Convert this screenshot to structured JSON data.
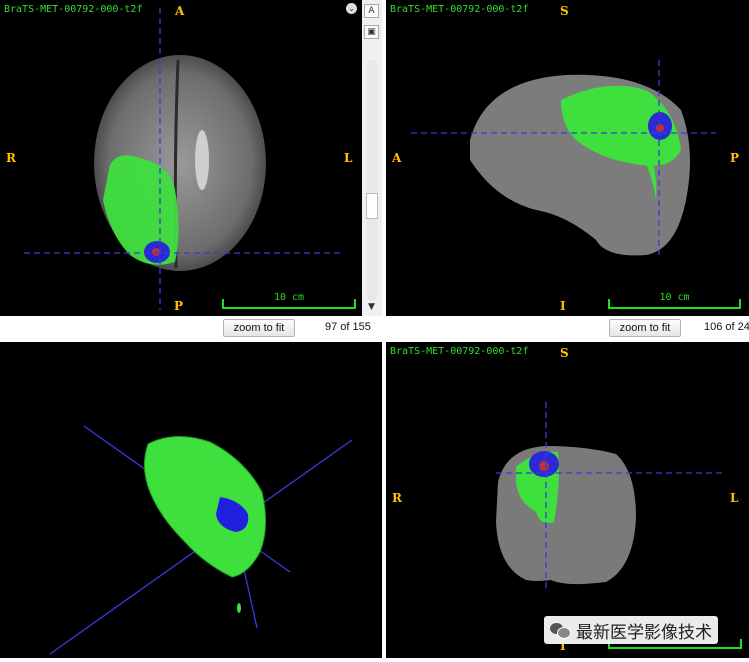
{
  "views": {
    "axial": {
      "label": "BraTS-MET-00792-000-t2f",
      "orient": {
        "top": "A",
        "left": "R",
        "right": "L",
        "bottom": "P"
      },
      "scale": "10 cm",
      "zoom_button": "zoom to fit",
      "slice": "97 of 155"
    },
    "sagittal": {
      "label": "BraTS-MET-00792-000-t2f",
      "orient": {
        "top": "S",
        "left": "A",
        "right": "P",
        "bottom": "I"
      },
      "scale": "10 cm",
      "zoom_button": "zoom to fit",
      "slice": "106 of 24"
    },
    "render3d": {},
    "coronal": {
      "label": "BraTS-MET-00792-000-t2f",
      "orient": {
        "top": "S",
        "left": "R",
        "right": "L",
        "bottom": "I"
      },
      "scale": "10 cm"
    }
  },
  "toolbar": {
    "annotate_icon_label": "A"
  },
  "watermark": {
    "text": "最新医学影像技术"
  },
  "colors": {
    "edema": "#3ee03e",
    "enhancing": "#2b2bd6",
    "necrosis": "#c0303a",
    "orient": "#ffc000",
    "crosshair": "#3b3bd8"
  }
}
